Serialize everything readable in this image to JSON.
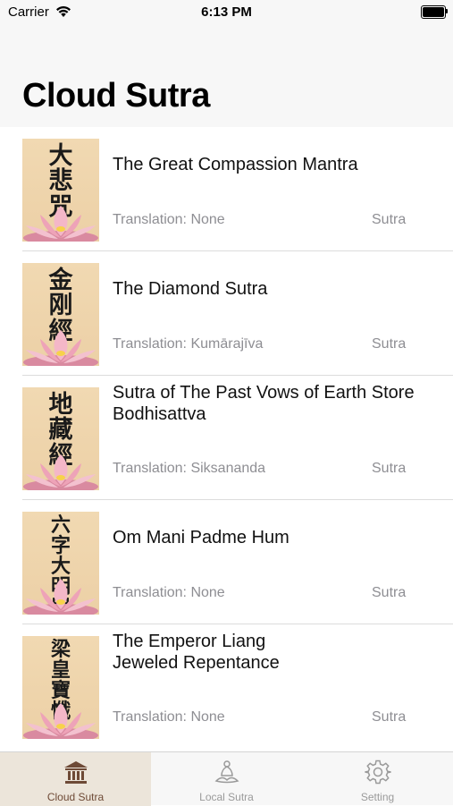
{
  "status_bar": {
    "carrier": "Carrier",
    "time": "6:13 PM"
  },
  "header": {
    "title": "Cloud Sutra"
  },
  "items": [
    {
      "title": "The Great Compassion Mantra",
      "cover_text": "大悲咒",
      "translation": "Translation: None",
      "category": "Sutra"
    },
    {
      "title": "The Diamond Sutra",
      "cover_text": "金刚經",
      "translation": "Translation: Kumārajīva",
      "category": "Sutra"
    },
    {
      "title": "Sutra of The Past Vows of Earth Store Bodhisattva",
      "cover_text": "地藏經",
      "translation": "Translation: Siksananda",
      "category": "Sutra"
    },
    {
      "title": "Om Mani Padme Hum",
      "cover_text": "六字大明咒",
      "translation": "Translation: None",
      "category": "Sutra"
    },
    {
      "title": "The Emperor Liang\nJeweled Repentance",
      "cover_text": "梁皇寶懺",
      "translation": "Translation: None",
      "category": "Sutra"
    }
  ],
  "tabs": [
    {
      "label": "Cloud Sutra",
      "icon": "temple-icon",
      "selected": true
    },
    {
      "label": "Local Sutra",
      "icon": "meditation-icon",
      "selected": false
    },
    {
      "label": "Setting",
      "icon": "gear-icon",
      "selected": false
    }
  ],
  "colors": {
    "tab_selected": "#6e4a36",
    "tab_selected_bg": "#ece5da",
    "cover_bg": "#f1d9b2",
    "secondary_text": "#8e8e93"
  }
}
